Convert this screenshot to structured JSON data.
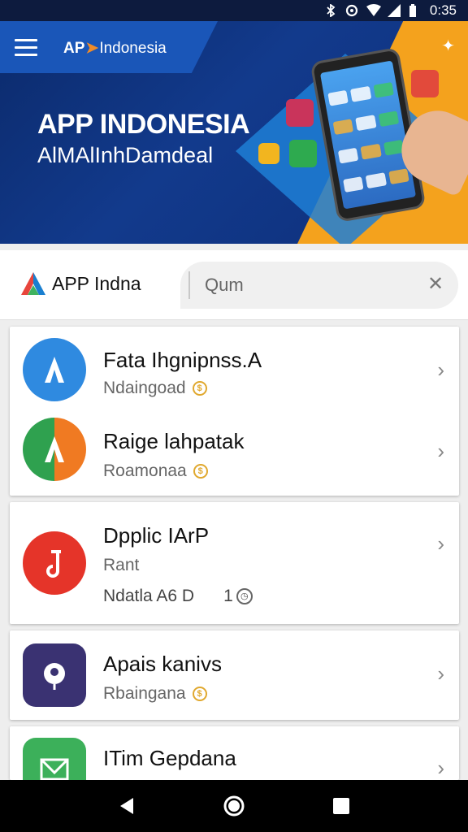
{
  "status_bar": {
    "time": "0:35"
  },
  "header": {
    "brand_prefix": "AP",
    "brand_suffix": "Indonesia"
  },
  "hero": {
    "title": "APP INDONESIA",
    "subtitle": "AlMAlInhDamdeal"
  },
  "search": {
    "logo_text": "APP Indna",
    "value": "Qum"
  },
  "list": [
    {
      "title": "Fata Ihgnipnss.A",
      "subtitle": "Ndaingoad",
      "icon": "a-app-icon",
      "color": "#2f8ae0"
    },
    {
      "title": "Raige lahpatak",
      "subtitle": "Roamonaa",
      "icon": "a-multicolor-app-icon",
      "color": "#f07a22"
    },
    {
      "title": "Dpplic IArP",
      "subtitle": "Rant",
      "meta": "Ndatla A6 D",
      "count": "1",
      "icon": "music-note-icon",
      "color": "#e53429"
    },
    {
      "title": "Apais kanivs",
      "subtitle": "Rbaingana",
      "icon": "balloon-app-icon",
      "color": "#3a3272"
    },
    {
      "title": "ITim Gepdana",
      "subtitle": "",
      "icon": "mail-icon",
      "color": "#3cb05a"
    }
  ]
}
